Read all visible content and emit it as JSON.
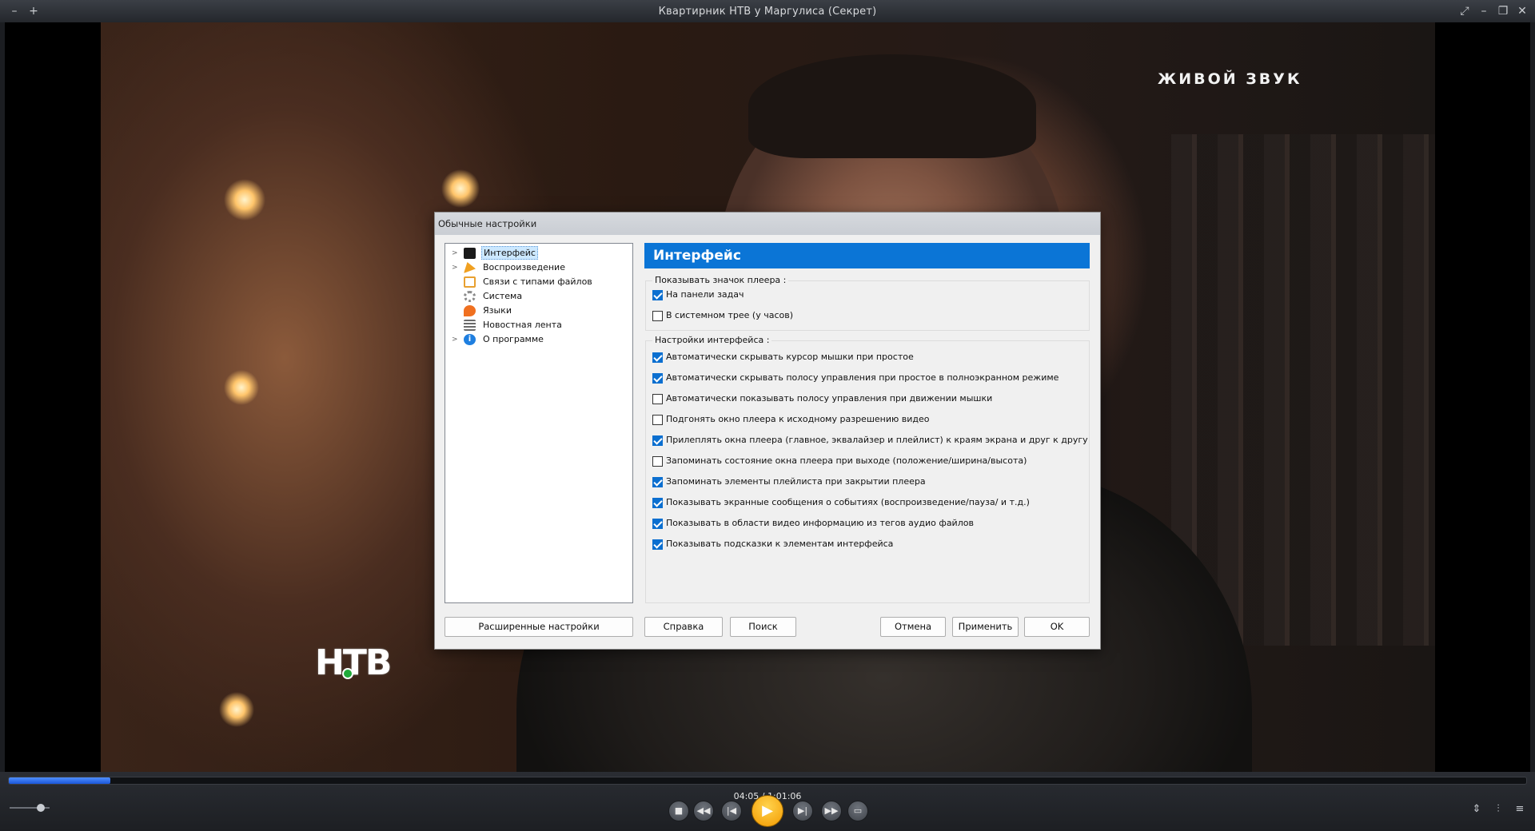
{
  "window": {
    "title": "Квартирник НТВ у Маргулиса  (Секрет)",
    "left_icons": [
      "minus-icon",
      "plus-icon"
    ],
    "right_icons": [
      "fullscreen-icon",
      "minimize-icon",
      "restore-icon",
      "close-icon"
    ]
  },
  "video": {
    "watermark": "ЖИВОЙ ЗВУК",
    "channel_logo": "НТВ"
  },
  "dialog": {
    "title": "Обычные настройки",
    "tree": [
      {
        "label": "Интерфейс",
        "expandable": true,
        "selected": true,
        "icon": "interface-icon",
        "color": "#1a1a1a"
      },
      {
        "label": "Воспроизведение",
        "expandable": true,
        "selected": false,
        "icon": "playback-icon",
        "color": "#f0a020"
      },
      {
        "label": "Связи с типами файлов",
        "expandable": false,
        "selected": false,
        "icon": "file-associations-icon",
        "color": "#e8a030"
      },
      {
        "label": "Система",
        "expandable": false,
        "selected": false,
        "icon": "system-gear-icon",
        "color": "#8a8a8a"
      },
      {
        "label": "Языки",
        "expandable": false,
        "selected": false,
        "icon": "languages-icon",
        "color": "#f07020"
      },
      {
        "label": "Новостная лента",
        "expandable": false,
        "selected": false,
        "icon": "news-feed-icon",
        "color": "#6a6a6a"
      },
      {
        "label": "О программе",
        "expandable": true,
        "selected": false,
        "icon": "info-icon",
        "color": "#1f7fe0"
      }
    ],
    "section_title": "Интерфейс",
    "group_icon": {
      "legend": "Показывать значок плеера :",
      "options": [
        {
          "label": "На панели задач",
          "checked": true
        },
        {
          "label": "В системном трее (у часов)",
          "checked": false
        }
      ]
    },
    "group_ui": {
      "legend": "Настройки интерфейса :",
      "options": [
        {
          "label": "Автоматически скрывать курсор мышки при простое",
          "checked": true
        },
        {
          "label": "Автоматически скрывать полосу управления при простое в полноэкранном режиме",
          "checked": true
        },
        {
          "label": "Автоматически показывать полосу управления при движении мышки",
          "checked": false
        },
        {
          "label": "Подгонять окно плеера к исходному разрешению видео",
          "checked": false
        },
        {
          "label": "Прилеплять окна плеера (главное, эквалайзер и плейлист) к краям экрана и друг к другу",
          "checked": true
        },
        {
          "label": "Запоминать состояние окна плеера при выходе (положение/ширина/высота)",
          "checked": false
        },
        {
          "label": "Запоминать элементы плейлиста при закрытии плеера",
          "checked": true
        },
        {
          "label": "Показывать экранные сообщения о событиях (воспроизведение/пауза/ и т.д.)",
          "checked": true
        },
        {
          "label": "Показывать в области видео информацию из тегов аудио файлов",
          "checked": true
        },
        {
          "label": "Показывать подсказки к элементам интерфейса",
          "checked": true
        }
      ]
    },
    "buttons": {
      "advanced": "Расширенные настройки",
      "help": "Справка",
      "search": "Поиск",
      "cancel": "Отмена",
      "apply": "Применить",
      "ok": "OK"
    }
  },
  "player": {
    "time": "04:05 / 1:01:06",
    "progress": 0.067,
    "volume": 0.78,
    "accent_color": "#2a6df0",
    "play_color": "#f5a300",
    "transport_icons": [
      "stop-icon",
      "rewind-icon",
      "previous-icon",
      "play-icon",
      "next-icon",
      "fast-forward-icon",
      "open-folder-icon"
    ],
    "right_icons": [
      "playlist-toggle-icon",
      "equalizer-icon",
      "settings-icon"
    ]
  }
}
